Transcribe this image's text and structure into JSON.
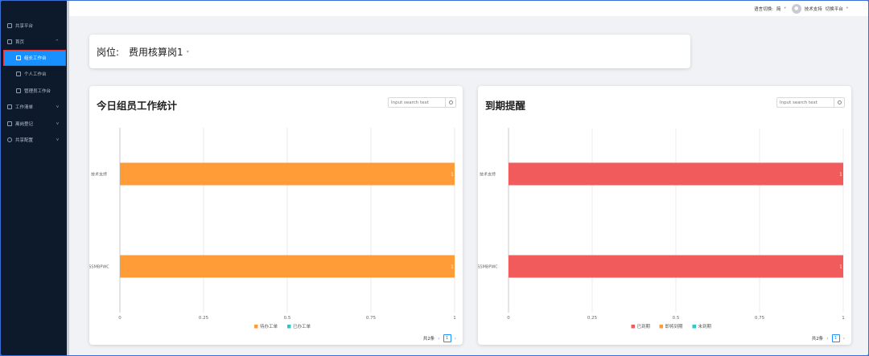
{
  "sidebar": {
    "items": [
      {
        "label": "共享平台"
      },
      {
        "label": "首页",
        "chev": "^"
      },
      {
        "label": "组长工作台"
      },
      {
        "label": "个人工作台"
      },
      {
        "label": "管理员工作台"
      },
      {
        "label": "工作清单",
        "chev": "v"
      },
      {
        "label": "离岗登记",
        "chev": "v"
      },
      {
        "label": "共享配置",
        "chev": "v"
      }
    ]
  },
  "topbar": {
    "lang_label": "语言切换:",
    "lang_value": "简",
    "user": "技术支持",
    "switch_platform": "切换平台"
  },
  "position": {
    "label": "岗位:",
    "value": "费用核算岗1"
  },
  "cards": [
    {
      "title": "今日组员工作统计",
      "search_placeholder": "Input search text",
      "pager_total": "共2条",
      "pager_page": "1"
    },
    {
      "title": "到期提醒",
      "search_placeholder": "Input search text",
      "pager_total": "共2条",
      "pager_page": "1"
    }
  ],
  "chart_data": [
    {
      "type": "bar",
      "orientation": "horizontal",
      "categories": [
        "技术支持",
        "SSMBPWC"
      ],
      "series": [
        {
          "name": "待办工单",
          "color": "#ff9c38",
          "values": [
            1,
            1
          ]
        },
        {
          "name": "已办工单",
          "color": "#2ec7c9",
          "values": [
            0,
            0
          ]
        }
      ],
      "data_labels": [
        "1",
        "1"
      ],
      "xticks": [
        "0",
        "0.25",
        "0.5",
        "0.75",
        "1"
      ],
      "xlim": [
        0,
        1
      ],
      "grid": true,
      "legend": "bottom"
    },
    {
      "type": "bar",
      "orientation": "horizontal",
      "categories": [
        "技术支持",
        "SSMBPWC"
      ],
      "series": [
        {
          "name": "已到期",
          "color": "#f15b5b",
          "values": [
            1,
            1
          ]
        },
        {
          "name": "即将到期",
          "color": "#ff9c38",
          "values": [
            0,
            0
          ]
        },
        {
          "name": "未到期",
          "color": "#2ec7c9",
          "values": [
            0,
            0
          ]
        }
      ],
      "data_labels": [
        "1",
        "1"
      ],
      "xticks": [
        "0",
        "0.25",
        "0.5",
        "0.75",
        "1"
      ],
      "xlim": [
        0,
        1
      ],
      "grid": true,
      "legend": "bottom"
    }
  ]
}
